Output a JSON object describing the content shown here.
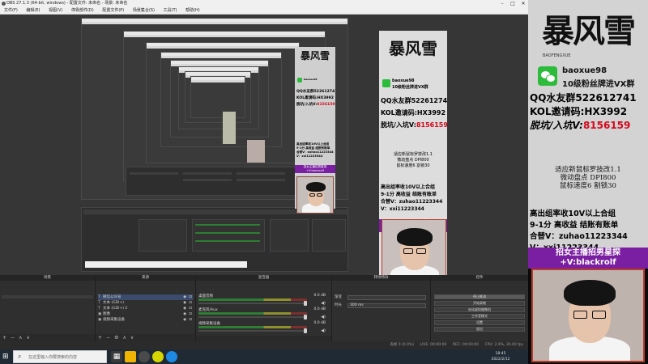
{
  "window": {
    "title": "OBS 27.1.3 (64-bit, windows) - 配置文件: 未命名 - 场景: 未命名",
    "menu": [
      "文件(F)",
      "编辑(E)",
      "视图(V)",
      "停靠部件(D)",
      "配置文件(P)",
      "场景集合(S)",
      "工具(T)",
      "帮助(H)"
    ]
  },
  "docks": {
    "scenes": {
      "title": "场景"
    },
    "sources": {
      "title": "来源",
      "items": [
        {
          "icon": "T",
          "label": "微信公众号"
        },
        {
          "icon": "T",
          "label": "文本 (GDI+)"
        },
        {
          "icon": "T",
          "label": "文本 (GDI+) 2"
        },
        {
          "icon": "▣",
          "label": "图像"
        },
        {
          "icon": "▣",
          "label": "视频采集设备"
        }
      ]
    },
    "mixer": {
      "title": "混音器",
      "channels": [
        {
          "name": "桌面音频",
          "db": "0.0 dB"
        },
        {
          "name": "麦克风/Aux",
          "db": "0.0 dB"
        },
        {
          "name": "视频采集设备",
          "db": "0.0 dB"
        }
      ]
    },
    "transitions": {
      "title": "转场特效",
      "rows": [
        {
          "label": "渐变",
          "value": ""
        },
        {
          "label": "时长",
          "value": "300 ms"
        }
      ]
    },
    "controls": {
      "title": "控件",
      "buttons": [
        "停止推流",
        "开始录制",
        "启动虚拟摄像机",
        "工作室模式",
        "设置",
        "退出"
      ]
    }
  },
  "status": {
    "dropped": "丢帧 0 (0.0%)",
    "live": "LIVE: 00:00:00",
    "rec": "REC: 00:00:00",
    "cpu": "CPU: 2.9%, 30.00 fps"
  },
  "taskbar": {
    "search_placeholder": "在这里输入你要搜索的内容",
    "time": "18:45",
    "date": "2022/2/12"
  },
  "poster": {
    "logo": "暴风雪",
    "logo_sub": "BAOFENGXUE",
    "wechat_id": "baoxue98",
    "wechat_group": "10级粉丝牌进VX群",
    "qq_group": "QQ水友群522612741",
    "kol_code": "KOL邀请码:HX3992",
    "pk_prefix": "脱坑/入坑V:",
    "pk_number": "8156159",
    "tips": [
      "适应新鼠标罗技改1.1",
      "微动盘点 DPI800",
      "鼠标速度6 割锁30"
    ],
    "deal": [
      "高出组率收10V以上合组",
      "9-1分 高收益 结账有账单",
      "合替V：zuhao11223344",
      "V：xxi11223344"
    ],
    "recruit": [
      "招女主播招男星探",
      "+V:blackrolf"
    ]
  },
  "colors": {
    "accent_red": "#d4071c",
    "recruit_purple": "#7b1fa2",
    "wechat_green": "#2dbb3c",
    "obs_bg": "#2b2b2b"
  }
}
